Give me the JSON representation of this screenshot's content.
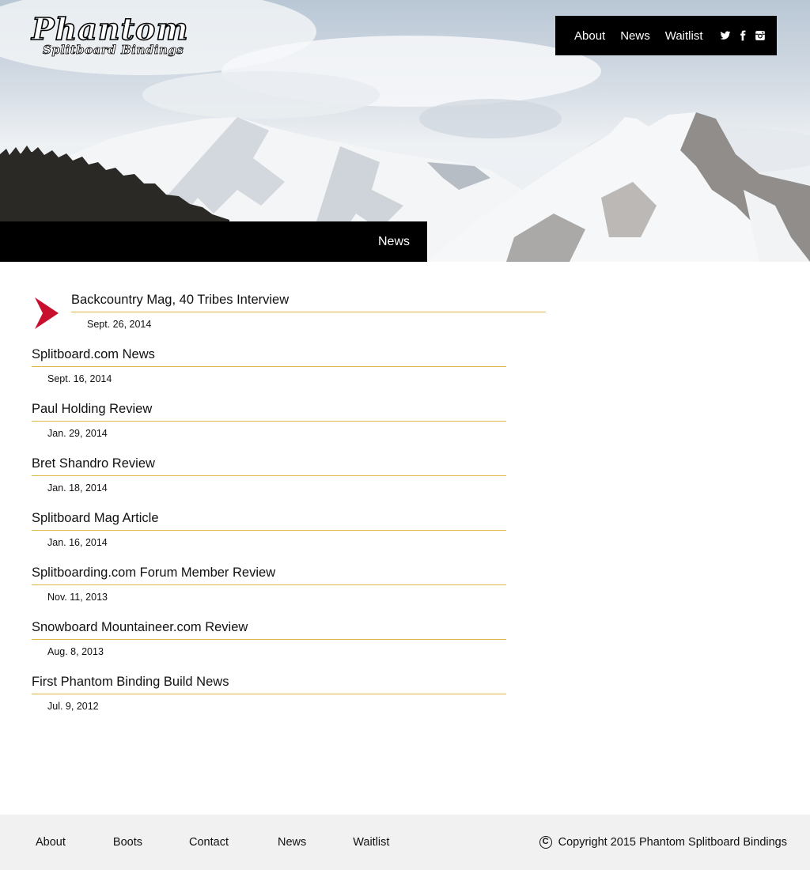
{
  "brand": {
    "title": "Phantom",
    "subtitle": "Splitboard Bindings"
  },
  "topnav": {
    "items": [
      {
        "label": "About"
      },
      {
        "label": "News"
      },
      {
        "label": "Waitlist"
      }
    ],
    "social": [
      "twitter-icon",
      "facebook-icon",
      "instagram-icon"
    ]
  },
  "banner": {
    "label": "News"
  },
  "news": {
    "items": [
      {
        "title": "Backcountry Mag, 40 Tribes Interview",
        "date": "Sept. 26, 2014"
      },
      {
        "title": "Splitboard.com News",
        "date": "Sept. 16, 2014"
      },
      {
        "title": "Paul Holding Review",
        "date": "Jan. 29, 2014"
      },
      {
        "title": "Bret Shandro Review",
        "date": "Jan. 18, 2014"
      },
      {
        "title": "Splitboard Mag Article",
        "date": "Jan. 16, 2014"
      },
      {
        "title": "Splitboarding.com Forum Member Review",
        "date": "Nov. 11, 2013"
      },
      {
        "title": "Snowboard Mountaineer.com Review",
        "date": "Aug. 8, 2013"
      },
      {
        "title": "First Phantom Binding Build News",
        "date": "Jul. 9, 2012"
      }
    ]
  },
  "footer": {
    "nav": [
      {
        "label": "About"
      },
      {
        "label": "Boots"
      },
      {
        "label": "Contact"
      },
      {
        "label": "News"
      },
      {
        "label": "Waitlist"
      }
    ],
    "copyright_symbol": "C",
    "copyright": "Copyright 2015 Phantom Splitboard Bindings"
  },
  "colors": {
    "accent_arrow": "#c8102e",
    "divider": "#e0b84a",
    "nav_bg": "#000000",
    "footer_bg": "#f1f1f1"
  }
}
